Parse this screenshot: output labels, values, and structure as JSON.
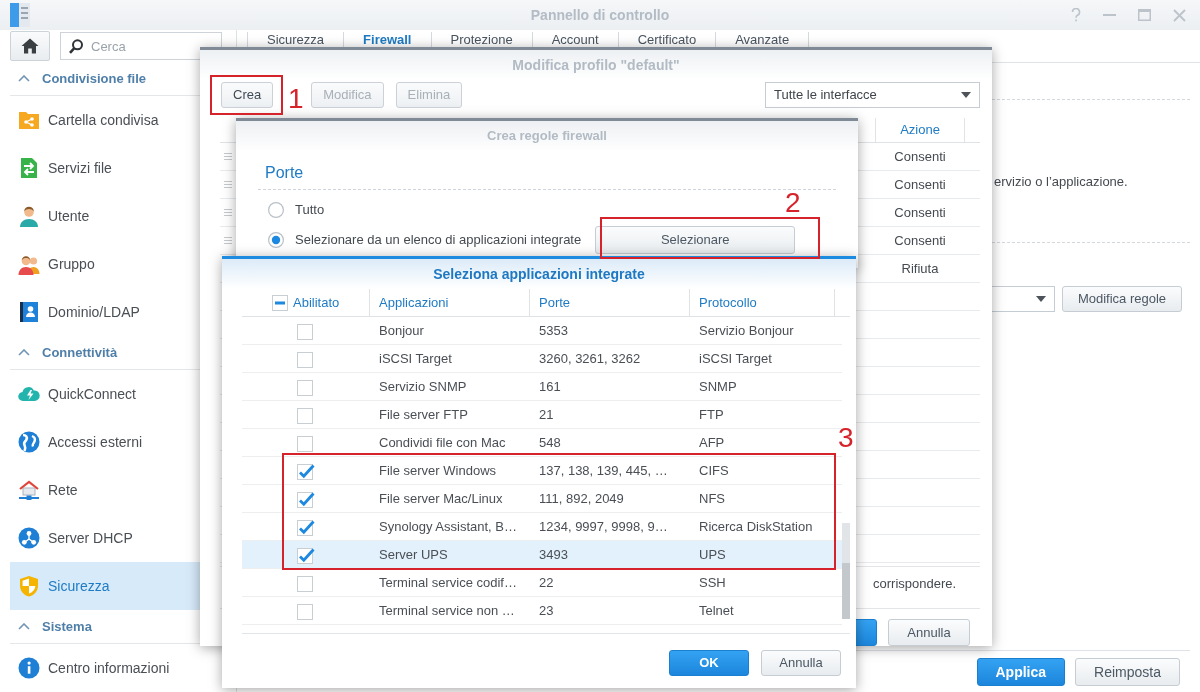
{
  "window": {
    "title": "Pannello di controllo"
  },
  "sidebar": {
    "search": {
      "placeholder": "Cerca"
    },
    "sections": [
      {
        "title": "Condivisione file",
        "expanded": true,
        "items": [
          {
            "label": "Cartella condivisa",
            "kind": "shared-folder",
            "selected": false
          },
          {
            "label": "Servizi file",
            "kind": "file-services",
            "selected": false
          },
          {
            "label": "Utente",
            "kind": "user",
            "selected": false
          },
          {
            "label": "Gruppo",
            "kind": "group",
            "selected": false
          },
          {
            "label": "Dominio/LDAP",
            "kind": "directory",
            "selected": false
          }
        ]
      },
      {
        "title": "Connettività",
        "expanded": true,
        "items": [
          {
            "label": "QuickConnect",
            "kind": "cloud",
            "selected": false
          },
          {
            "label": "Accessi esterni",
            "kind": "globe",
            "selected": false
          },
          {
            "label": "Rete",
            "kind": "network",
            "selected": false
          },
          {
            "label": "Server DHCP",
            "kind": "dhcp",
            "selected": false
          },
          {
            "label": "Sicurezza",
            "kind": "shield",
            "selected": true
          }
        ]
      },
      {
        "title": "Sistema",
        "expanded": true,
        "items": [
          {
            "label": "Centro informazioni",
            "kind": "info",
            "selected": false
          }
        ]
      }
    ]
  },
  "tabs": [
    {
      "label": "Sicurezza",
      "selected": false
    },
    {
      "label": "Firewall",
      "selected": true
    },
    {
      "label": "Protezione",
      "selected": false
    },
    {
      "label": "Account",
      "selected": false
    },
    {
      "label": "Certificato",
      "selected": false
    },
    {
      "label": "Avanzate",
      "selected": false
    }
  ],
  "content": {
    "description": "ervizio o l’applicazione.",
    "rules_button": "Modifica regole",
    "buttons": [
      {
        "label": "Applica",
        "kind": "primary"
      },
      {
        "label": "Reimposta",
        "kind": "secondary"
      }
    ]
  },
  "profile_dialog": {
    "title": "Modifica profilo \"default\"",
    "toolbar": [
      {
        "label": "Crea",
        "disabled": false
      },
      {
        "label": "Modifica",
        "disabled": true
      },
      {
        "label": "Elimina",
        "disabled": true
      }
    ],
    "interface_select": {
      "value": "Tutte le interfacce"
    },
    "table": {
      "columns": [
        "Azione"
      ],
      "rows": [
        {
          "action": "Consenti",
          "handle": true
        },
        {
          "action": "Consenti",
          "handle": true
        },
        {
          "action": "Consenti",
          "handle": true
        },
        {
          "action": "Consenti",
          "handle": true
        },
        {
          "action": "Rifiuta",
          "handle": false
        }
      ]
    },
    "note": "corrispondere.",
    "buttons": [
      {
        "label": "Annulla",
        "kind": "secondary"
      }
    ]
  },
  "rule_dialog": {
    "title": "Crea regole firewall",
    "section": "Porte",
    "options": [
      {
        "label": "Tutto",
        "selected": false
      },
      {
        "label": "Selezionare da un elenco di applicazioni integrate",
        "selected": true,
        "button": "Selezionare"
      }
    ]
  },
  "apps_dialog": {
    "title": "Seleziona applicazioni integrate",
    "select_all": {
      "indeterminate": true
    },
    "columns": [
      "Abilitato",
      "Applicazioni",
      "Porte",
      "Protocollo"
    ],
    "rows": [
      {
        "checked": false,
        "selected": false,
        "app": "Bonjour",
        "ports": "5353",
        "protocol": "Servizio Bonjour"
      },
      {
        "checked": false,
        "selected": false,
        "app": "iSCSI Target",
        "ports": "3260, 3261, 3262",
        "protocol": "iSCSI Target"
      },
      {
        "checked": false,
        "selected": false,
        "app": "Servizio SNMP",
        "ports": "161",
        "protocol": "SNMP"
      },
      {
        "checked": false,
        "selected": false,
        "app": "File server FTP",
        "ports": "21",
        "protocol": "FTP"
      },
      {
        "checked": false,
        "selected": false,
        "app": "Condividi file con Mac",
        "ports": "548",
        "protocol": "AFP"
      },
      {
        "checked": true,
        "selected": false,
        "app": "File server Windows",
        "ports": "137, 138, 139, 445, …",
        "protocol": "CIFS"
      },
      {
        "checked": true,
        "selected": false,
        "app": "File server Mac/Linux",
        "ports": "111, 892, 2049",
        "protocol": "NFS"
      },
      {
        "checked": true,
        "selected": false,
        "app": "Synology Assistant, B…",
        "ports": "1234, 9997, 9998, 9…",
        "protocol": "Ricerca DiskStation"
      },
      {
        "checked": true,
        "selected": true,
        "app": "Server UPS",
        "ports": "3493",
        "protocol": "UPS"
      },
      {
        "checked": false,
        "selected": false,
        "app": "Terminal service codif…",
        "ports": "22",
        "protocol": "SSH"
      },
      {
        "checked": false,
        "selected": false,
        "app": "Terminal service non …",
        "ports": "23",
        "protocol": "Telnet"
      }
    ],
    "buttons": [
      {
        "label": "OK",
        "kind": "primary"
      },
      {
        "label": "Annulla",
        "kind": "secondary"
      }
    ]
  },
  "annotations": [
    {
      "label": "1"
    },
    {
      "label": "2"
    },
    {
      "label": "3"
    }
  ]
}
